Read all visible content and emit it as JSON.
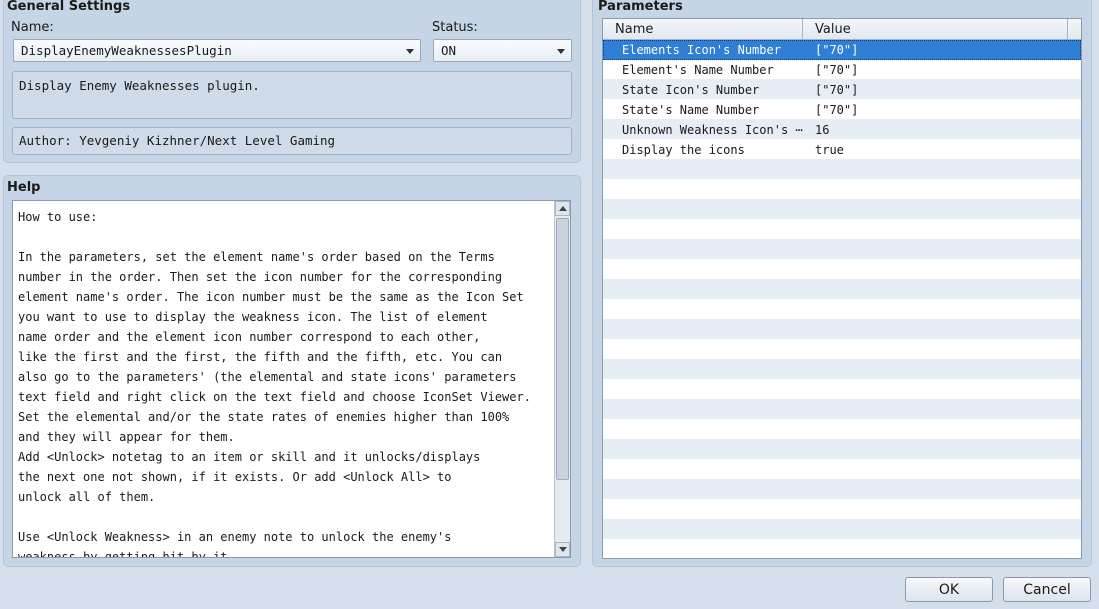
{
  "general": {
    "title": "General Settings",
    "name_label": "Name:",
    "name_value": "DisplayEnemyWeaknessesPlugin",
    "status_label": "Status:",
    "status_value": "ON",
    "description": "Display Enemy Weaknesses plugin.",
    "author": "Author: Yevgeniy Kizhner/Next Level Gaming"
  },
  "help": {
    "title": "Help",
    "text": "How to use:\n\nIn the parameters, set the element name's order based on the Terms\nnumber in the order. Then set the icon number for the corresponding\nelement name's order. The icon number must be the same as the Icon Set\nyou want to use to display the weakness icon. The list of element\nname order and the element icon number correspond to each other,\nlike the first and the first, the fifth and the fifth, etc. You can\nalso go to the parameters' (the elemental and state icons' parameters\ntext field and right click on the text field and choose IconSet Viewer.\nSet the elemental and/or the state rates of enemies higher than 100%\nand they will appear for them.\nAdd <Unlock> notetag to an item or skill and it unlocks/displays\nthe next one not shown, if it exists. Or add <Unlock All> to\nunlock all of them.\n\nUse <Unlock Weakness> in an enemy note to unlock the enemy's\nweakness by getting hit by it."
  },
  "parameters": {
    "title": "Parameters",
    "columns": [
      "Name",
      "Value"
    ],
    "rows": [
      {
        "name": "Elements Icon's Number",
        "value": "[\"70\"]"
      },
      {
        "name": "Element's Name Number",
        "value": "[\"70\"]"
      },
      {
        "name": "State Icon's Number",
        "value": "[\"70\"]"
      },
      {
        "name": "State's Name Number",
        "value": "[\"70\"]"
      },
      {
        "name": "Unknown Weakness Icon's ⋯",
        "value": "16"
      },
      {
        "name": "Display the icons",
        "value": "true"
      }
    ],
    "selected_index": 0
  },
  "buttons": {
    "ok": "OK",
    "cancel": "Cancel"
  }
}
